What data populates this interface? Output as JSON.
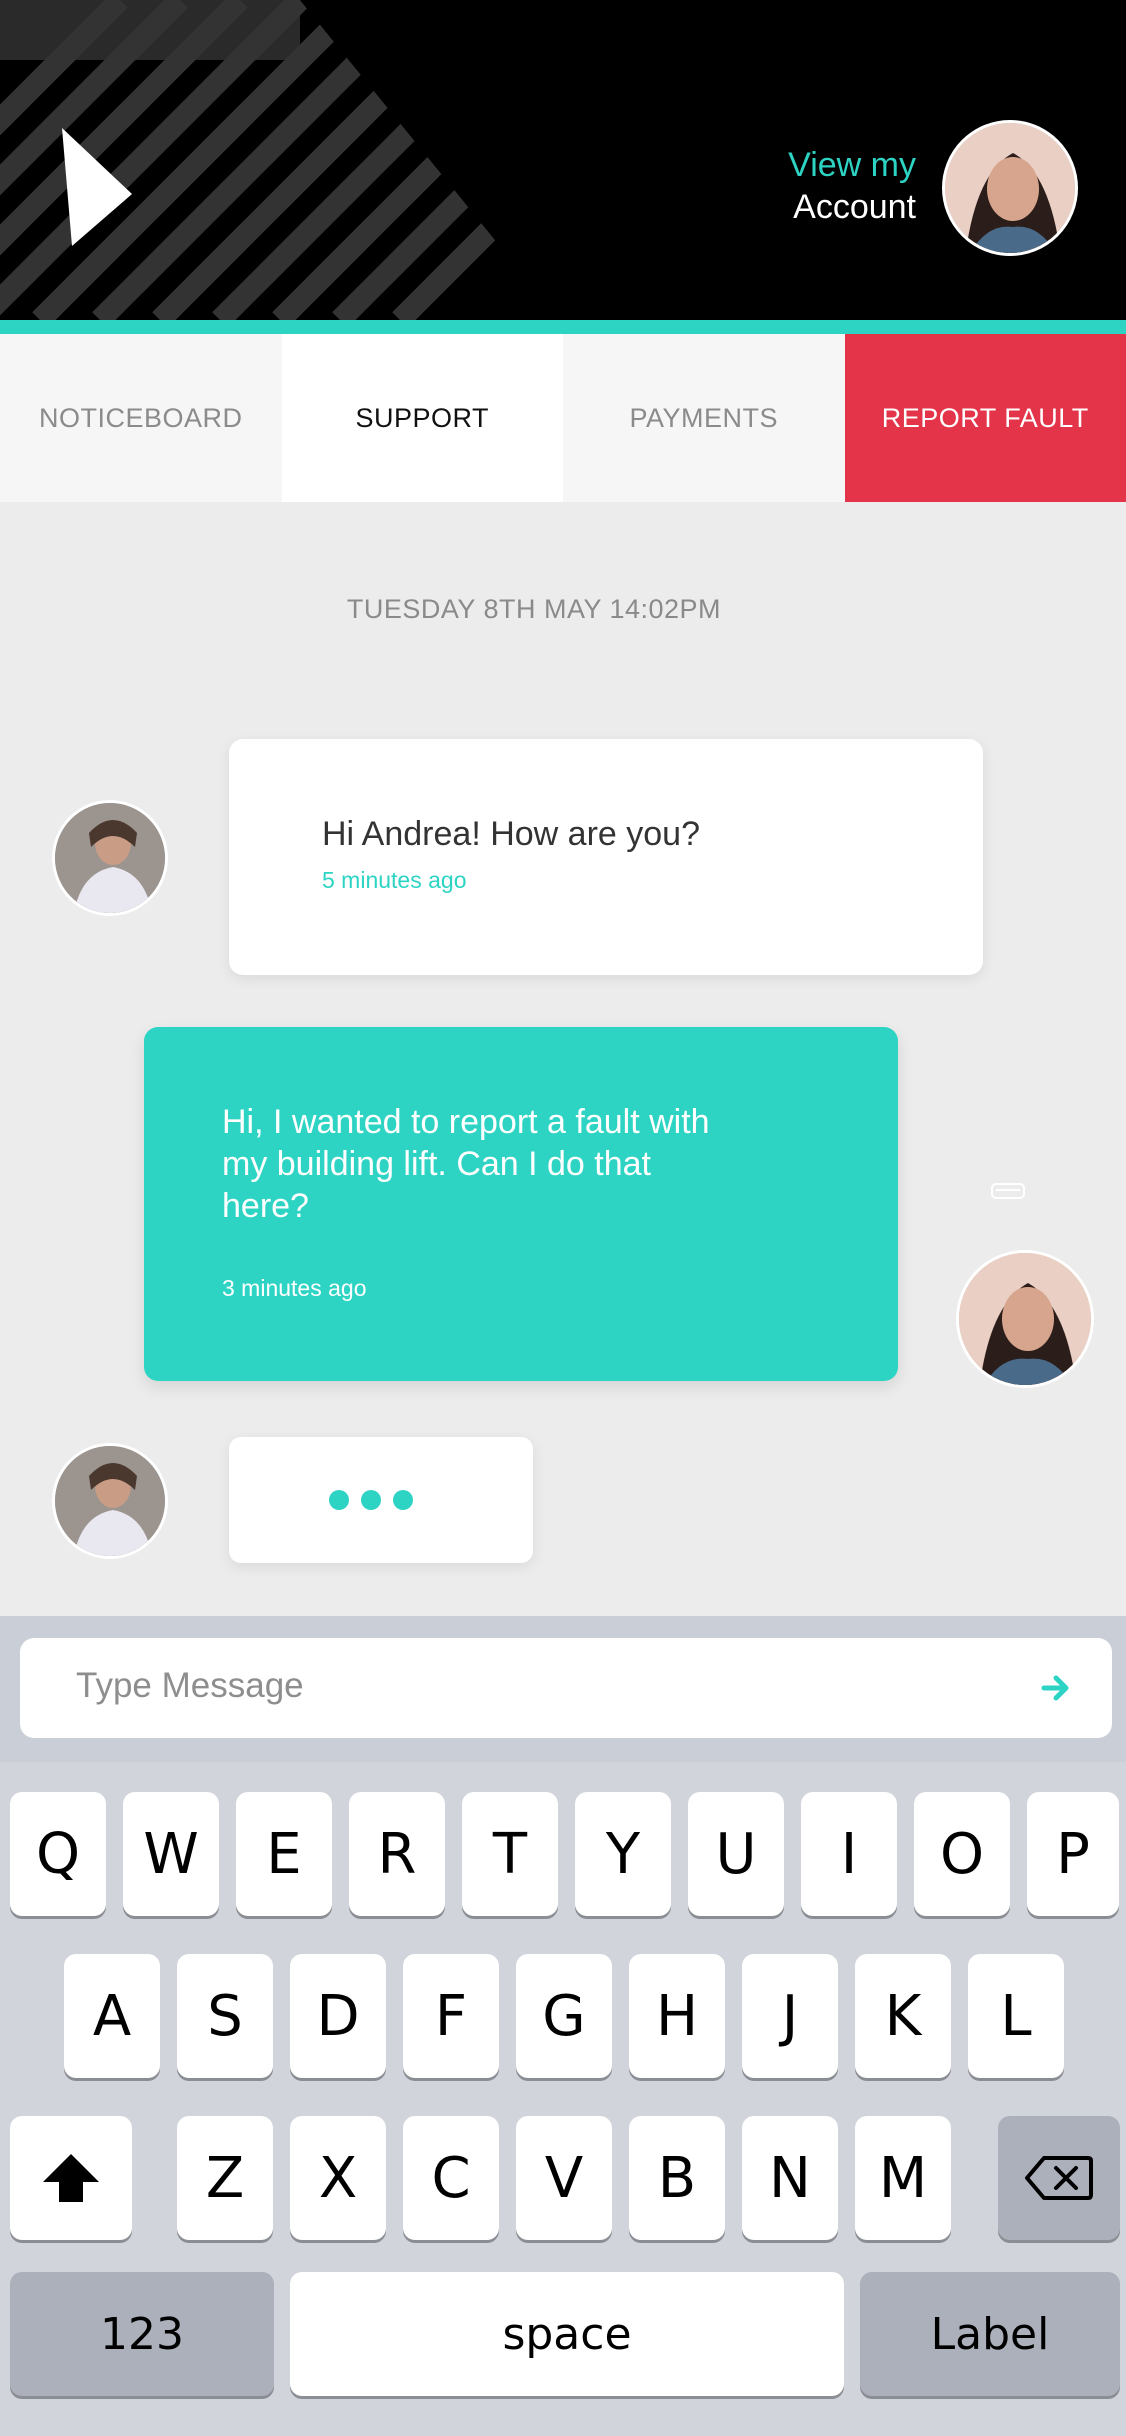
{
  "header": {
    "account_line1": "View my",
    "account_line2": "Account",
    "accent_color": "#2dd4c4"
  },
  "tabs": [
    {
      "label": "NOTICEBOARD"
    },
    {
      "label": "SUPPORT"
    },
    {
      "label": "PAYMENTS"
    },
    {
      "label": "REPORT FAULT"
    }
  ],
  "chat": {
    "date": "TUESDAY 8TH MAY 14:02PM",
    "messages": [
      {
        "text": "Hi Andrea! How are you?",
        "time": "5 minutes ago",
        "from": "agent"
      },
      {
        "text": "Hi, I wanted to report a fault with my building lift. Can I do that here?",
        "time": "3 minutes ago",
        "from": "me"
      }
    ]
  },
  "composer": {
    "placeholder": "Type Message",
    "send_icon": "arrow-right-icon"
  },
  "keyboard": {
    "row1": [
      "Q",
      "W",
      "E",
      "R",
      "T",
      "Y",
      "U",
      "I",
      "O",
      "P"
    ],
    "row2": [
      "A",
      "S",
      "D",
      "F",
      "G",
      "H",
      "J",
      "K",
      "L"
    ],
    "row3": [
      "Z",
      "X",
      "C",
      "V",
      "B",
      "N",
      "M"
    ],
    "numbers": "123",
    "space": "space",
    "return": "Label"
  }
}
